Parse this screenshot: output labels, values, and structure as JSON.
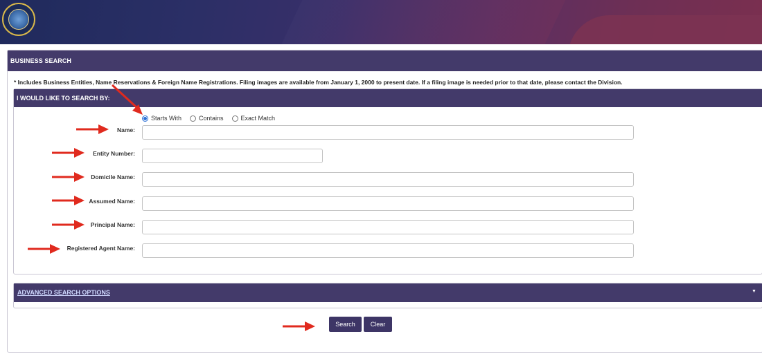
{
  "banner": {
    "seal_alt": "Great Seal of the State of Utah"
  },
  "panel": {
    "title": "BUSINESS SEARCH",
    "note": "* Includes Business Entities, Name Reservations & Foreign Name Registrations. Filing images are available from January 1, 2000 to present date. If a filing image is needed prior to that date, please contact the Division."
  },
  "search_by": {
    "title": "I WOULD LIKE TO SEARCH BY:",
    "match_options": [
      {
        "label": "Starts With",
        "checked": true
      },
      {
        "label": "Contains",
        "checked": false
      },
      {
        "label": "Exact Match",
        "checked": false
      }
    ],
    "fields": [
      {
        "label": "Name:",
        "value": ""
      },
      {
        "label": "Entity Number:",
        "value": ""
      },
      {
        "label": "Domicile Name:",
        "value": ""
      },
      {
        "label": "Assumed Name:",
        "value": ""
      },
      {
        "label": "Principal Name:",
        "value": ""
      },
      {
        "label": "Registered Agent Name:",
        "value": ""
      }
    ]
  },
  "advanced": {
    "label": "ADVANCED SEARCH OPTIONS",
    "caret_icon": "caret-down-icon"
  },
  "actions": {
    "search_label": "Search",
    "clear_label": "Clear"
  },
  "colors": {
    "header_purple": "#433a6a",
    "arrow_red": "#e02a1e",
    "radio_blue": "#2a6fd6"
  }
}
